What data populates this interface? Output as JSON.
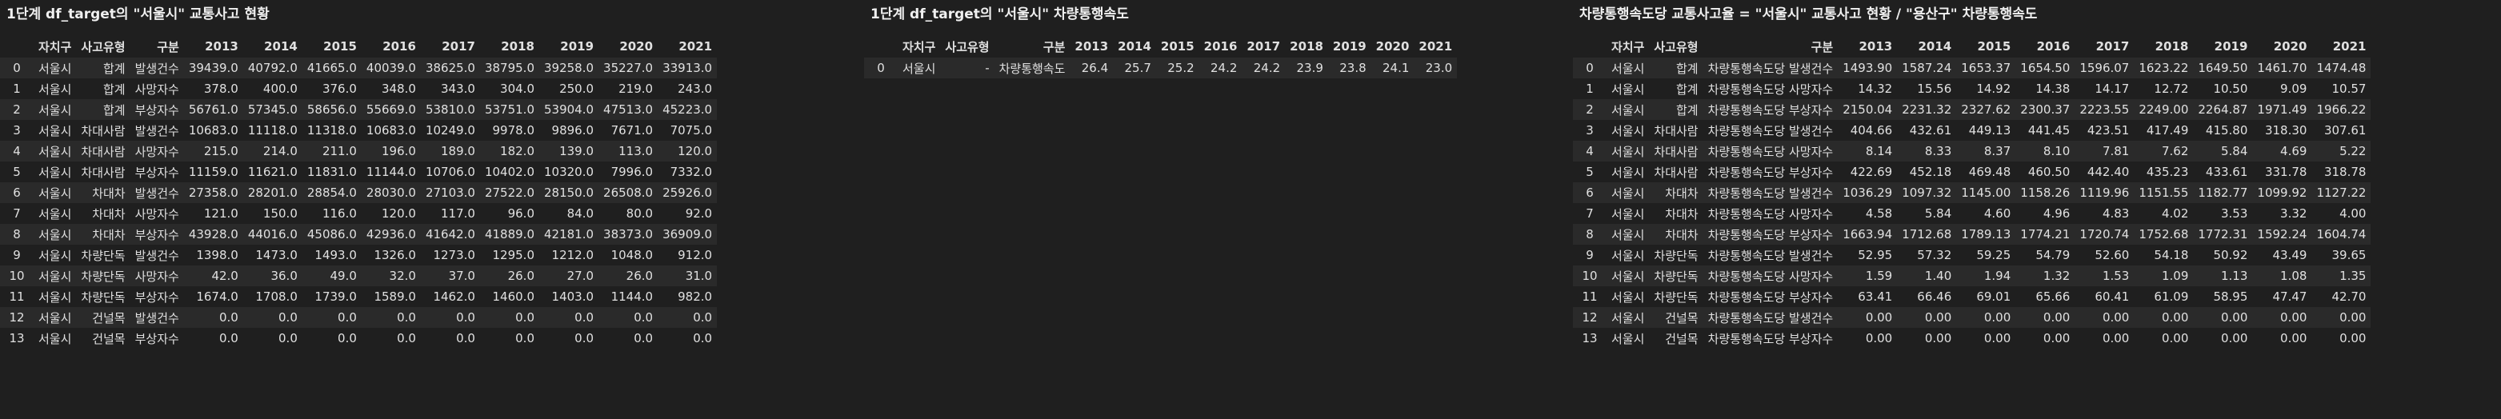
{
  "panel1": {
    "title": "1단계 df_target의 \"서울시\" 교통사고 현황",
    "columns": [
      "",
      "자치구",
      "사고유형",
      "구분",
      "2013",
      "2014",
      "2015",
      "2016",
      "2017",
      "2018",
      "2019",
      "2020",
      "2021"
    ],
    "rows": [
      [
        "0",
        "서울시",
        "합계",
        "발생건수",
        "39439.0",
        "40792.0",
        "41665.0",
        "40039.0",
        "38625.0",
        "38795.0",
        "39258.0",
        "35227.0",
        "33913.0"
      ],
      [
        "1",
        "서울시",
        "합계",
        "사망자수",
        "378.0",
        "400.0",
        "376.0",
        "348.0",
        "343.0",
        "304.0",
        "250.0",
        "219.0",
        "243.0"
      ],
      [
        "2",
        "서울시",
        "합계",
        "부상자수",
        "56761.0",
        "57345.0",
        "58656.0",
        "55669.0",
        "53810.0",
        "53751.0",
        "53904.0",
        "47513.0",
        "45223.0"
      ],
      [
        "3",
        "서울시",
        "차대사람",
        "발생건수",
        "10683.0",
        "11118.0",
        "11318.0",
        "10683.0",
        "10249.0",
        "9978.0",
        "9896.0",
        "7671.0",
        "7075.0"
      ],
      [
        "4",
        "서울시",
        "차대사람",
        "사망자수",
        "215.0",
        "214.0",
        "211.0",
        "196.0",
        "189.0",
        "182.0",
        "139.0",
        "113.0",
        "120.0"
      ],
      [
        "5",
        "서울시",
        "차대사람",
        "부상자수",
        "11159.0",
        "11621.0",
        "11831.0",
        "11144.0",
        "10706.0",
        "10402.0",
        "10320.0",
        "7996.0",
        "7332.0"
      ],
      [
        "6",
        "서울시",
        "차대차",
        "발생건수",
        "27358.0",
        "28201.0",
        "28854.0",
        "28030.0",
        "27103.0",
        "27522.0",
        "28150.0",
        "26508.0",
        "25926.0"
      ],
      [
        "7",
        "서울시",
        "차대차",
        "사망자수",
        "121.0",
        "150.0",
        "116.0",
        "120.0",
        "117.0",
        "96.0",
        "84.0",
        "80.0",
        "92.0"
      ],
      [
        "8",
        "서울시",
        "차대차",
        "부상자수",
        "43928.0",
        "44016.0",
        "45086.0",
        "42936.0",
        "41642.0",
        "41889.0",
        "42181.0",
        "38373.0",
        "36909.0"
      ],
      [
        "9",
        "서울시",
        "차량단독",
        "발생건수",
        "1398.0",
        "1473.0",
        "1493.0",
        "1326.0",
        "1273.0",
        "1295.0",
        "1212.0",
        "1048.0",
        "912.0"
      ],
      [
        "10",
        "서울시",
        "차량단독",
        "사망자수",
        "42.0",
        "36.0",
        "49.0",
        "32.0",
        "37.0",
        "26.0",
        "27.0",
        "26.0",
        "31.0"
      ],
      [
        "11",
        "서울시",
        "차량단독",
        "부상자수",
        "1674.0",
        "1708.0",
        "1739.0",
        "1589.0",
        "1462.0",
        "1460.0",
        "1403.0",
        "1144.0",
        "982.0"
      ],
      [
        "12",
        "서울시",
        "건널목",
        "발생건수",
        "0.0",
        "0.0",
        "0.0",
        "0.0",
        "0.0",
        "0.0",
        "0.0",
        "0.0",
        "0.0"
      ],
      [
        "13",
        "서울시",
        "건널목",
        "부상자수",
        "0.0",
        "0.0",
        "0.0",
        "0.0",
        "0.0",
        "0.0",
        "0.0",
        "0.0",
        "0.0"
      ]
    ]
  },
  "panel2": {
    "title": "1단계 df_target의 \"서울시\" 차량통행속도",
    "columns": [
      "",
      "자치구",
      "사고유형",
      "구분",
      "2013",
      "2014",
      "2015",
      "2016",
      "2017",
      "2018",
      "2019",
      "2020",
      "2021"
    ],
    "rows": [
      [
        "0",
        "서울시",
        "-",
        "차량통행속도",
        "26.4",
        "25.7",
        "25.2",
        "24.2",
        "24.2",
        "23.9",
        "23.8",
        "24.1",
        "23.0"
      ]
    ]
  },
  "panel3": {
    "title": "차량통행속도당 교통사고율 = \"서울시\" 교통사고 현황 / \"용산구\" 차량통행속도",
    "columns": [
      "",
      "자치구",
      "사고유형",
      "구분",
      "2013",
      "2014",
      "2015",
      "2016",
      "2017",
      "2018",
      "2019",
      "2020",
      "2021"
    ],
    "rows": [
      [
        "0",
        "서울시",
        "합계",
        "차량통행속도당 발생건수",
        "1493.90",
        "1587.24",
        "1653.37",
        "1654.50",
        "1596.07",
        "1623.22",
        "1649.50",
        "1461.70",
        "1474.48"
      ],
      [
        "1",
        "서울시",
        "합계",
        "차량통행속도당 사망자수",
        "14.32",
        "15.56",
        "14.92",
        "14.38",
        "14.17",
        "12.72",
        "10.50",
        "9.09",
        "10.57"
      ],
      [
        "2",
        "서울시",
        "합계",
        "차량통행속도당 부상자수",
        "2150.04",
        "2231.32",
        "2327.62",
        "2300.37",
        "2223.55",
        "2249.00",
        "2264.87",
        "1971.49",
        "1966.22"
      ],
      [
        "3",
        "서울시",
        "차대사람",
        "차량통행속도당 발생건수",
        "404.66",
        "432.61",
        "449.13",
        "441.45",
        "423.51",
        "417.49",
        "415.80",
        "318.30",
        "307.61"
      ],
      [
        "4",
        "서울시",
        "차대사람",
        "차량통행속도당 사망자수",
        "8.14",
        "8.33",
        "8.37",
        "8.10",
        "7.81",
        "7.62",
        "5.84",
        "4.69",
        "5.22"
      ],
      [
        "5",
        "서울시",
        "차대사람",
        "차량통행속도당 부상자수",
        "422.69",
        "452.18",
        "469.48",
        "460.50",
        "442.40",
        "435.23",
        "433.61",
        "331.78",
        "318.78"
      ],
      [
        "6",
        "서울시",
        "차대차",
        "차량통행속도당 발생건수",
        "1036.29",
        "1097.32",
        "1145.00",
        "1158.26",
        "1119.96",
        "1151.55",
        "1182.77",
        "1099.92",
        "1127.22"
      ],
      [
        "7",
        "서울시",
        "차대차",
        "차량통행속도당 사망자수",
        "4.58",
        "5.84",
        "4.60",
        "4.96",
        "4.83",
        "4.02",
        "3.53",
        "3.32",
        "4.00"
      ],
      [
        "8",
        "서울시",
        "차대차",
        "차량통행속도당 부상자수",
        "1663.94",
        "1712.68",
        "1789.13",
        "1774.21",
        "1720.74",
        "1752.68",
        "1772.31",
        "1592.24",
        "1604.74"
      ],
      [
        "9",
        "서울시",
        "차량단독",
        "차량통행속도당 발생건수",
        "52.95",
        "57.32",
        "59.25",
        "54.79",
        "52.60",
        "54.18",
        "50.92",
        "43.49",
        "39.65"
      ],
      [
        "10",
        "서울시",
        "차량단독",
        "차량통행속도당 사망자수",
        "1.59",
        "1.40",
        "1.94",
        "1.32",
        "1.53",
        "1.09",
        "1.13",
        "1.08",
        "1.35"
      ],
      [
        "11",
        "서울시",
        "차량단독",
        "차량통행속도당 부상자수",
        "63.41",
        "66.46",
        "69.01",
        "65.66",
        "60.41",
        "61.09",
        "58.95",
        "47.47",
        "42.70"
      ],
      [
        "12",
        "서울시",
        "건널목",
        "차량통행속도당 발생건수",
        "0.00",
        "0.00",
        "0.00",
        "0.00",
        "0.00",
        "0.00",
        "0.00",
        "0.00",
        "0.00"
      ],
      [
        "13",
        "서울시",
        "건널목",
        "차량통행속도당 부상자수",
        "0.00",
        "0.00",
        "0.00",
        "0.00",
        "0.00",
        "0.00",
        "0.00",
        "0.00",
        "0.00"
      ]
    ]
  }
}
